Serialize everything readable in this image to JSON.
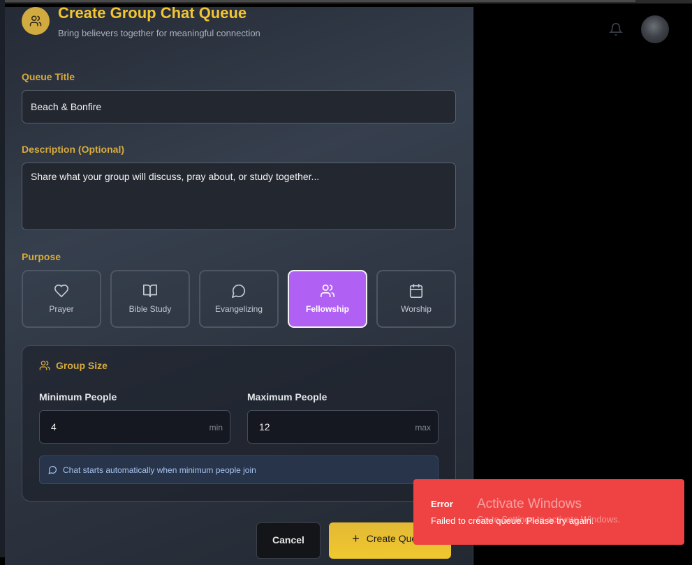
{
  "header": {
    "title": "Create Group Chat Queue",
    "subtitle": "Bring believers together for meaningful connection"
  },
  "form": {
    "queue_title_label": "Queue Title",
    "queue_title_value": "Beach & Bonfire",
    "description_label": "Description (Optional)",
    "description_placeholder": "Share what your group will discuss, pray about, or study together...",
    "purpose_label": "Purpose",
    "purposes": [
      {
        "label": "Prayer",
        "icon": "heart-icon",
        "selected": false
      },
      {
        "label": "Bible Study",
        "icon": "book-icon",
        "selected": false
      },
      {
        "label": "Evangelizing",
        "icon": "chat-bubble-icon",
        "selected": false
      },
      {
        "label": "Fellowship",
        "icon": "users-icon",
        "selected": true
      },
      {
        "label": "Worship",
        "icon": "calendar-icon",
        "selected": false
      }
    ],
    "group_size": {
      "title": "Group Size",
      "min_label": "Minimum People",
      "min_value": "4",
      "min_unit": "min",
      "max_label": "Maximum People",
      "max_value": "12",
      "max_unit": "max",
      "info": "Chat starts automatically when minimum people join"
    },
    "cancel_label": "Cancel",
    "create_label": "Create Queue"
  },
  "toast": {
    "title": "Error",
    "message": "Failed to create queue. Please try again."
  },
  "watermark": {
    "line1": "Activate Windows",
    "line2": "Go to Settings to activate Windows."
  },
  "colors": {
    "accent": "#f2c531",
    "selected": "#b061f3",
    "error": "#ef4343"
  }
}
